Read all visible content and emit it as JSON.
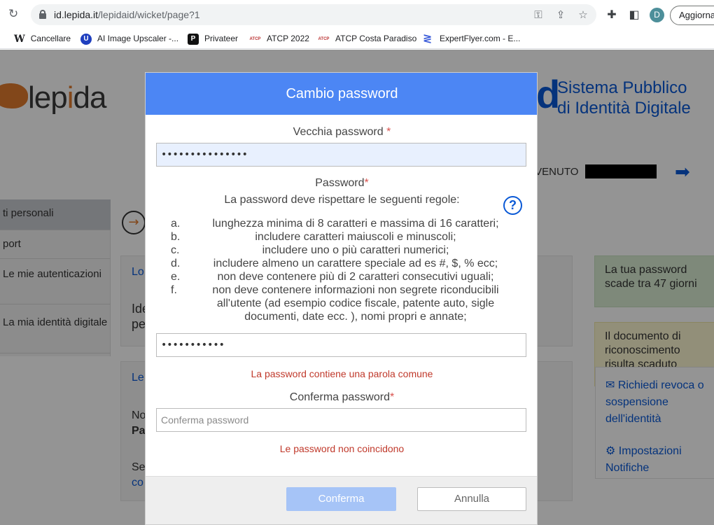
{
  "browser": {
    "url_domain": "id.lepida.it",
    "url_path": "/lepidaid/wicket/page?1",
    "update_button": "Aggiorna",
    "avatar_letter": "D",
    "bookmarks": [
      {
        "icon": "wikipedia-icon",
        "glyph": "W",
        "label": "Cancellare"
      },
      {
        "icon": "upscaler-icon",
        "glyph": "U",
        "label": "AI Image Upscaler -..."
      },
      {
        "icon": "privateer-icon",
        "glyph": "P",
        "label": "Privateer"
      },
      {
        "icon": "atcp-icon",
        "glyph": "ATCP",
        "label": "ATCP 2022"
      },
      {
        "icon": "atcp-icon",
        "glyph": "ATCP",
        "label": "ATCP Costa Paradiso"
      },
      {
        "icon": "expertflyer-icon",
        "glyph": "≷",
        "label": "ExpertFlyer.com - E..."
      }
    ]
  },
  "site": {
    "logo_text_a": "lep",
    "logo_text_dot": "i",
    "logo_text_b": "da",
    "spid_letter": "d",
    "spid_line1": "Sistema Pubblico",
    "spid_line2": "di Identità Digitale",
    "welcome": "IVENUTO",
    "sidebar": [
      "ti personali",
      "port",
      "Le mie autenticazioni",
      "La mia identità digitale"
    ],
    "card1_title": "Lo",
    "card1_body": "Ide\npe",
    "card2_title": "Le",
    "card2_line1": "No",
    "card2_line2": "Pa",
    "card2_line3": "Se",
    "card2_line4": "co",
    "notice_password": "La tua password scade tra 47 giorni",
    "notice_document": "Il documento di riconoscimento risulta scaduto",
    "link_revoke": "Richiedi revoca o sospensione dell'identità",
    "link_settings": "Impostazioni Notifiche"
  },
  "modal": {
    "title": "Cambio password",
    "old_password_label": "Vecchia password",
    "old_password_value": "•••••••••••••••",
    "password_label": "Password",
    "rules_intro": "La password deve rispettare le seguenti regole:",
    "rules": [
      {
        "letter": "a.",
        "text": "lunghezza minima di 8 caratteri e massima di 16 caratteri;"
      },
      {
        "letter": "b.",
        "text": "includere caratteri maiuscoli e minuscoli;"
      },
      {
        "letter": "c.",
        "text": "includere uno o più caratteri numerici;"
      },
      {
        "letter": "d.",
        "text": "includere almeno un carattere speciale ad es #, $, % ecc;"
      },
      {
        "letter": "e.",
        "text": "non deve contenere più di 2 caratteri consecutivi uguali;"
      },
      {
        "letter": "f.",
        "text": "non deve contenere informazioni non segrete riconducibili all'utente (ad esempio codice fiscale, patente auto, sigle documenti, date ecc. ), nomi propri e annate;"
      }
    ],
    "new_password_value": "•••••••••••",
    "error_common": "La password contiene una parola comune",
    "confirm_label": "Conferma password",
    "confirm_placeholder": "Conferma password",
    "error_mismatch": "Le password non coincidono",
    "confirm_button": "Conferma",
    "cancel_button": "Annulla"
  }
}
